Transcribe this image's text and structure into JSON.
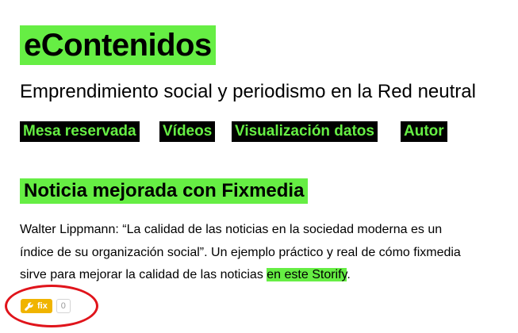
{
  "site": {
    "title": "eContenidos",
    "tagline": "Emprendimiento social y periodismo en la Red neutral"
  },
  "nav": {
    "items": [
      {
        "label": "Mesa reservada"
      },
      {
        "label": "Vídeos"
      },
      {
        "label": "Visualización datos"
      },
      {
        "label": "Autor"
      }
    ]
  },
  "post": {
    "title": "Noticia mejorada con Fixmedia",
    "body_lines": [
      "Walter Lippmann: “La calidad de las noticias en la sociedad moderna es un",
      "índice de su organización social”. Un ejemplo práctico y real de cómo fixmedia",
      "sirve para mejorar la calidad de las noticias "
    ],
    "link_text": "en este Storify",
    "trailing": "."
  },
  "fix_widget": {
    "label": "fix",
    "count": "0",
    "icon": "wrench-icon"
  },
  "colors": {
    "accent": "#66ee44",
    "nav_bg": "#000000",
    "fix_button": "#f0b400",
    "annotation": "#e0141b"
  }
}
